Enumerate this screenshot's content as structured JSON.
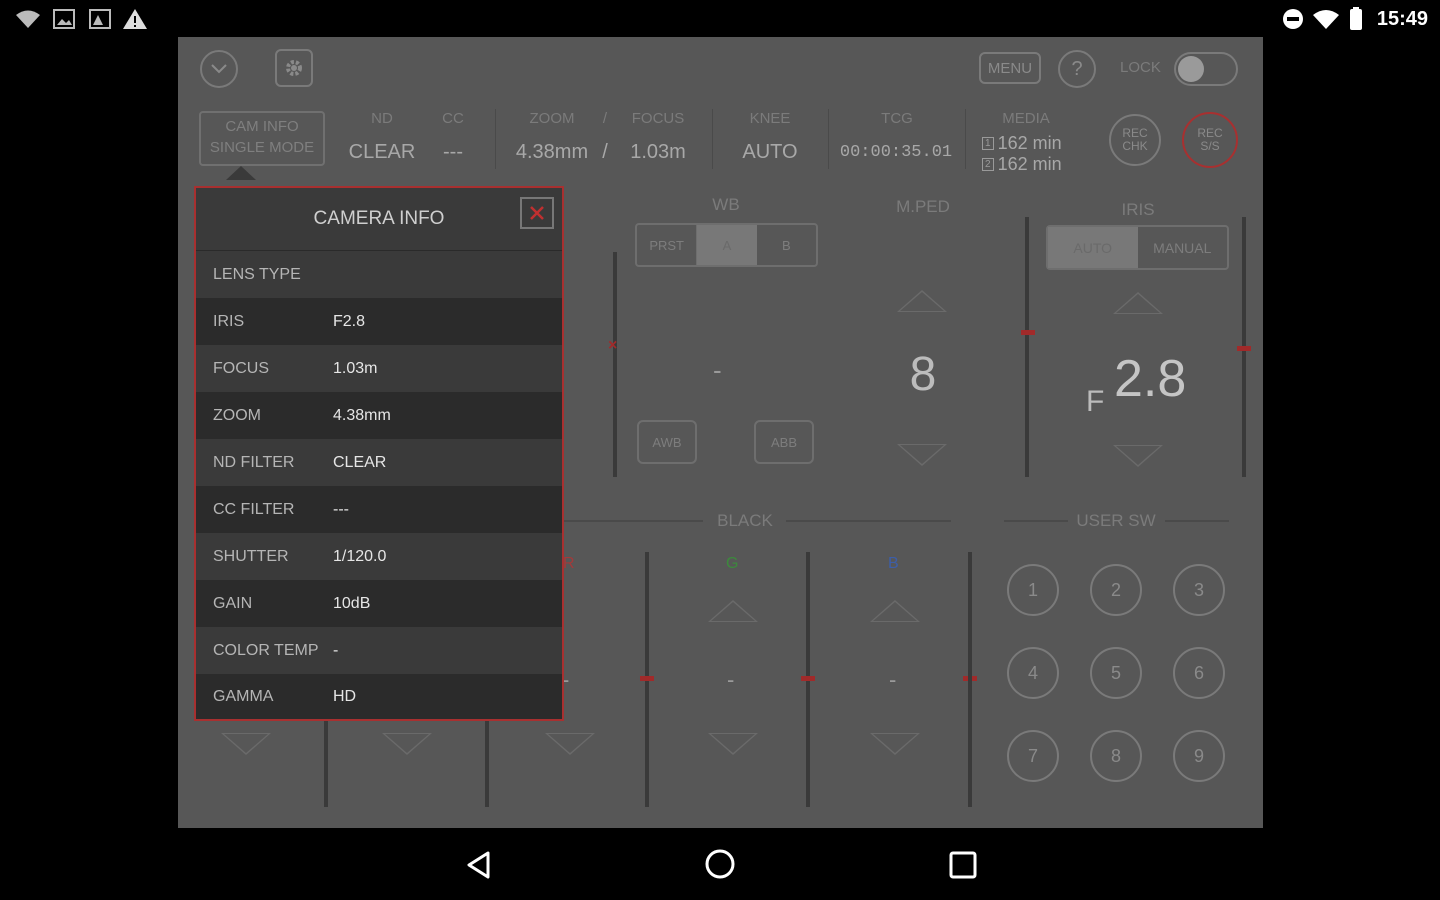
{
  "status_bar": {
    "time": "15:49"
  },
  "toolbar": {
    "menu_label": "MENU",
    "help_label": "?",
    "lock_label": "LOCK"
  },
  "header": {
    "cam_info": {
      "line1": "CAM INFO",
      "line2": "SINGLE MODE"
    },
    "nd": {
      "label": "ND",
      "value": "CLEAR"
    },
    "cc": {
      "label": "CC",
      "value": "---"
    },
    "zoom": {
      "label": "ZOOM",
      "value": "4.38mm"
    },
    "slash1": "/",
    "slash2": "/",
    "focus": {
      "label": "FOCUS",
      "value": "1.03m"
    },
    "knee": {
      "label": "KNEE",
      "value": "AUTO"
    },
    "tcg": {
      "label": "TCG",
      "value": "00:00:35.01"
    },
    "media": {
      "label": "MEDIA",
      "slot1_num": "1",
      "slot1": "162 min",
      "slot2_num": "2",
      "slot2": "162 min"
    },
    "rec_chk": {
      "line1": "REC",
      "line2": "CHK"
    },
    "rec_ss": {
      "line1": "REC",
      "line2": "S/S"
    }
  },
  "wb": {
    "title": "WB",
    "prst": "PRST",
    "a": "A",
    "b": "B",
    "value": "-",
    "awb": "AWB",
    "abb": "ABB"
  },
  "mped": {
    "title": "M.PED",
    "value": "8"
  },
  "iris": {
    "title": "IRIS",
    "auto": "AUTO",
    "manual": "MANUAL",
    "f_prefix": "F",
    "value": "2.8"
  },
  "black": {
    "title": "BLACK",
    "r": {
      "label": "R",
      "value": "-"
    },
    "g": {
      "label": "G",
      "value": "-"
    },
    "b": {
      "label": "B",
      "value": "-"
    }
  },
  "user_sw": {
    "title": "USER SW",
    "buttons": [
      "1",
      "2",
      "3",
      "4",
      "5",
      "6",
      "7",
      "8",
      "9"
    ]
  },
  "camera_info": {
    "title": "CAMERA INFO",
    "rows": [
      {
        "label": "LENS TYPE",
        "value": ""
      },
      {
        "label": "IRIS",
        "value": "F2.8"
      },
      {
        "label": "FOCUS",
        "value": "1.03m"
      },
      {
        "label": "ZOOM",
        "value": "4.38mm"
      },
      {
        "label": "ND FILTER",
        "value": "CLEAR"
      },
      {
        "label": "CC FILTER",
        "value": "---"
      },
      {
        "label": "SHUTTER",
        "value": "1/120.0"
      },
      {
        "label": "GAIN",
        "value": "10dB"
      },
      {
        "label": "COLOR TEMP",
        "value": "-"
      },
      {
        "label": "GAMMA",
        "value": "HD"
      }
    ]
  },
  "colors": {
    "accent_red": "#a83030",
    "green": "#3c8a3c",
    "blue": "#3d5ea8",
    "red_label": "#a33a3a"
  }
}
